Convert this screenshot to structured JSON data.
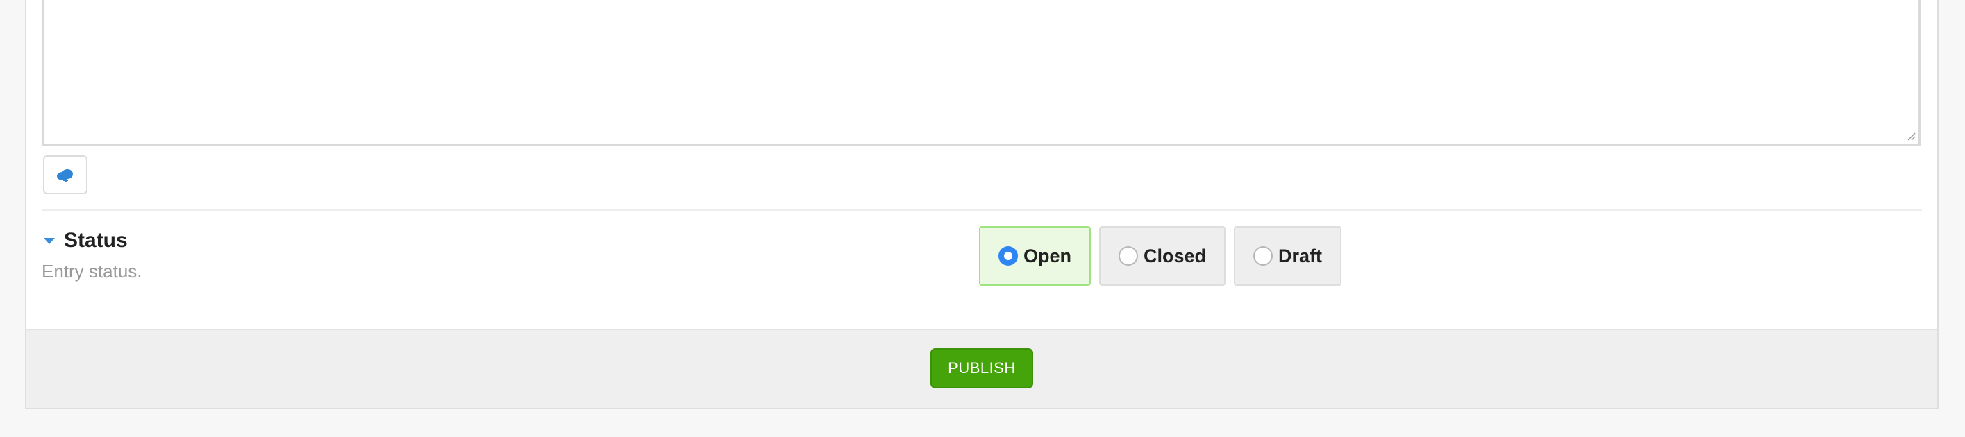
{
  "editor": {
    "text_value": ""
  },
  "toolbar": {
    "cloud_icon": "cloud-icon"
  },
  "status_field": {
    "label": "Status",
    "description": "Entry status.",
    "options": [
      {
        "label": "Open",
        "selected": true
      },
      {
        "label": "Closed",
        "selected": false
      },
      {
        "label": "Draft",
        "selected": false
      }
    ]
  },
  "footer": {
    "publish_label": "PUBLISH"
  },
  "colors": {
    "publish_green": "#46a40b",
    "selected_radio": "#2f86f2",
    "selected_option_bg": "#ecf9e2"
  }
}
